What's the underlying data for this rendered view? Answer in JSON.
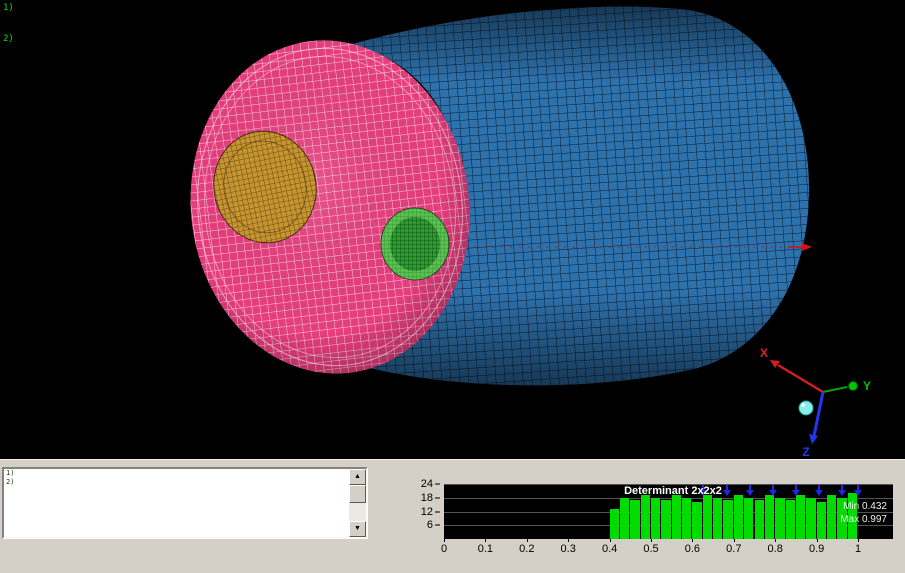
{
  "viewport": {
    "tags": [
      "1)",
      "2)"
    ],
    "triad": {
      "x": "X",
      "y": "Y",
      "z": "Z"
    }
  },
  "messages": {
    "lines": [
      "1)",
      "2)"
    ]
  },
  "scrollbar": {
    "up_icon": "▲",
    "down_icon": "▼"
  },
  "chart_data": {
    "type": "bar",
    "title": "Determinant 2x2x2",
    "stats": {
      "min": "Min 0.432",
      "max": "Max 0.997"
    },
    "ylim": [
      0,
      24
    ],
    "y_ticks": [
      {
        "label": "24",
        "v": 24
      },
      {
        "label": "18",
        "v": 18
      },
      {
        "label": "12",
        "v": 12
      },
      {
        "label": "6",
        "v": 6
      }
    ],
    "x_ticks": [
      {
        "label": "0",
        "v": 0
      },
      {
        "label": "0.1",
        "v": 0.1
      },
      {
        "label": "0.2",
        "v": 0.2
      },
      {
        "label": "0.3",
        "v": 0.3
      },
      {
        "label": "0.4",
        "v": 0.4
      },
      {
        "label": "0.5",
        "v": 0.5
      },
      {
        "label": "0.6",
        "v": 0.6
      },
      {
        "label": "0.7",
        "v": 0.7
      },
      {
        "label": "0.8",
        "v": 0.8
      },
      {
        "label": "0.9",
        "v": 0.9
      },
      {
        "label": "1",
        "v": 1
      }
    ],
    "bin_start": 0.4,
    "bin_width": 0.025,
    "values": [
      13,
      18,
      17,
      19,
      18,
      17,
      19,
      18,
      16,
      19,
      18,
      17,
      19,
      18,
      17,
      19,
      18,
      17,
      19,
      18,
      16,
      19,
      18,
      20
    ],
    "markers": [
      0.625,
      0.684,
      0.739,
      0.795,
      0.85,
      0.906,
      0.961,
      1.0
    ],
    "bar_color": "#00dc00",
    "marker_color": "#2424e8",
    "plot_bg": "#000000",
    "grid": true,
    "legend": "none"
  },
  "colors": {
    "viewport_bg": "#000000",
    "panel_bg": "#d4d0c8",
    "cylinder_body": "#2e72ad",
    "front_face": "#e63e7e",
    "inclusion_gold": "#c6952f",
    "inclusion_green": "#2e9a33",
    "inclusion_green_ring": "#58c24e",
    "centerline_red": "#d01414",
    "axis_x": "#e02020",
    "axis_y": "#00c400",
    "axis_z": "#2536f0"
  }
}
